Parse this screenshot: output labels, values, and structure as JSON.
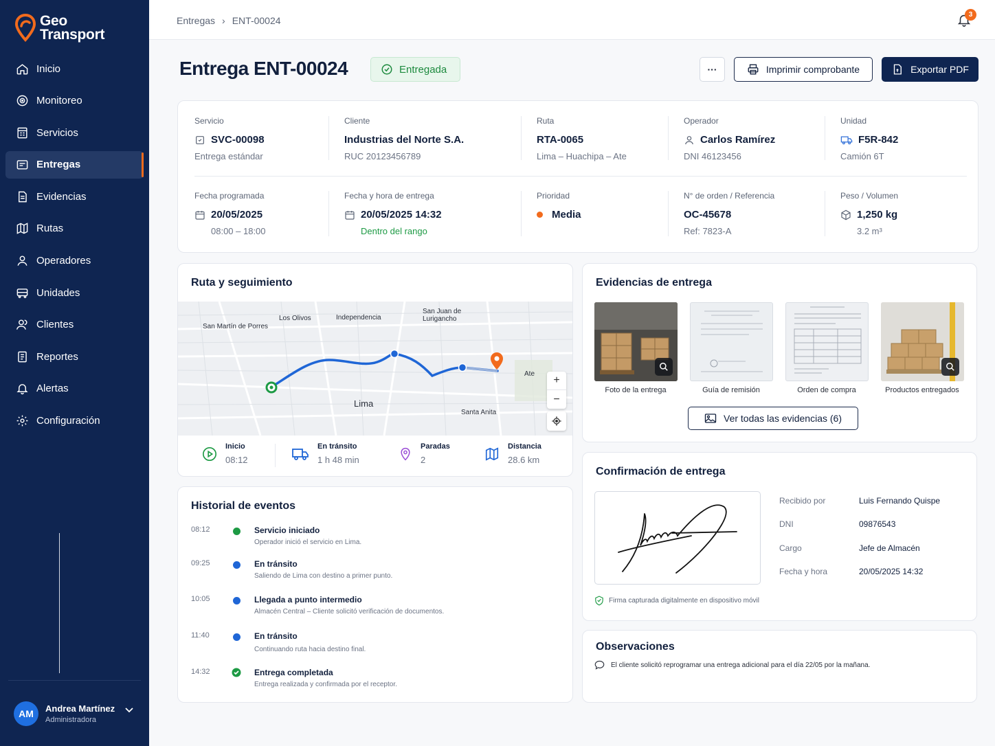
{
  "app": {
    "logo_line1": "Geo",
    "logo_line2": "Transport"
  },
  "sidebar": {
    "items": [
      {
        "label": "Inicio",
        "icon": "home-icon"
      },
      {
        "label": "Monitoreo",
        "icon": "monitor-icon"
      },
      {
        "label": "Servicios",
        "icon": "services-icon"
      },
      {
        "label": "Entregas",
        "icon": "deliveries-icon",
        "active": true
      },
      {
        "label": "Evidencias",
        "icon": "evidence-icon"
      },
      {
        "label": "Rutas",
        "icon": "routes-icon"
      },
      {
        "label": "Operadores",
        "icon": "operators-icon"
      },
      {
        "label": "Unidades",
        "icon": "units-icon"
      },
      {
        "label": "Clientes",
        "icon": "clients-icon"
      },
      {
        "label": "Reportes",
        "icon": "reports-icon"
      },
      {
        "label": "Alertas",
        "icon": "alerts-icon"
      },
      {
        "label": "Configuración",
        "icon": "settings-icon"
      }
    ],
    "user": {
      "initials": "AM",
      "name": "Andrea Martínez",
      "role": "Administradora"
    }
  },
  "topbar": {
    "breadcrumb": [
      "Entregas",
      "ENT-00024"
    ],
    "notifications": "3"
  },
  "header": {
    "title": "Entrega ENT-00024",
    "status": "Entregada",
    "more": "···",
    "print": "Imprimir comprobante",
    "export": "Exportar PDF"
  },
  "summary": {
    "servicio": {
      "label": "Servicio",
      "value": "SVC-00098",
      "sub": "Entrega estándar"
    },
    "cliente": {
      "label": "Cliente",
      "value": "Industrias del Norte S.A.",
      "sub": "RUC 20123456789"
    },
    "ruta": {
      "label": "Ruta",
      "value": "RTA-0065",
      "sub": "Lima – Huachipa – Ate"
    },
    "operador": {
      "label": "Operador",
      "value": "Carlos Ramírez",
      "sub": "DNI 46123456"
    },
    "unidad": {
      "label": "Unidad",
      "value": "F5R-842",
      "sub": "Camión 6T"
    },
    "fecha_prog": {
      "label": "Fecha programada",
      "value": "20/05/2025",
      "sub": "08:00 – 18:00"
    },
    "fecha_ent": {
      "label": "Fecha y hora de entrega",
      "value": "20/05/2025 14:32",
      "sub": "Dentro del rango"
    },
    "prioridad": {
      "label": "Prioridad",
      "value": "Media",
      "color": "#f26b1d"
    },
    "orden": {
      "label": "N° de orden / Referencia",
      "value": "OC-45678",
      "sub": "Ref: 7823-A"
    },
    "peso": {
      "label": "Peso / Volumen",
      "value": "1,250 kg",
      "sub": "3.2 m³"
    }
  },
  "route": {
    "title": "Ruta y seguimiento",
    "map_labels": {
      "san_martin": "San Martín de Porres",
      "los_olivos": "Los Olivos",
      "independencia": "Independencia",
      "san_juan": "San Juan de Lurigancho",
      "ate": "Ate",
      "lima": "Lima",
      "santa_anita": "Santa Anita"
    },
    "zoom_in": "+",
    "zoom_out": "−",
    "stats": [
      {
        "label": "Inicio",
        "value": "08:12",
        "icon": "play-icon"
      },
      {
        "label": "En tránsito",
        "value": "1 h 48 min",
        "icon": "truck-icon"
      },
      {
        "label": "Paradas",
        "value": "2",
        "icon": "pin-icon"
      },
      {
        "label": "Distancia",
        "value": "28.6 km",
        "icon": "map-icon"
      }
    ]
  },
  "history": {
    "title": "Historial de eventos",
    "events": [
      {
        "time": "08:12",
        "title": "Servicio iniciado",
        "desc": "Operador inició el servicio en Lima."
      },
      {
        "time": "09:25",
        "title": "En tránsito",
        "desc": "Saliendo de Lima con destino a primer punto."
      },
      {
        "time": "10:05",
        "title": "Llegada a punto intermedio",
        "desc": "Almacén Central – Cliente solicitó verificación de documentos."
      },
      {
        "time": "11:40",
        "title": "En tránsito",
        "desc": "Continuando ruta hacia destino final."
      },
      {
        "time": "14:32",
        "title": "Entrega completada",
        "desc": "Entrega realizada y confirmada por el receptor."
      }
    ]
  },
  "evidence": {
    "title": "Evidencias de entrega",
    "items": [
      {
        "caption": "Foto de la entrega"
      },
      {
        "caption": "Guía de remisión"
      },
      {
        "caption": "Orden de compra"
      },
      {
        "caption": "Productos entregados"
      }
    ],
    "view_all": "Ver todas las evidencias (6)"
  },
  "confirmation": {
    "title": "Confirmación de entrega",
    "fields": [
      {
        "label": "Recibido por",
        "value": "Luis Fernando Quispe"
      },
      {
        "label": "DNI",
        "value": "09876543"
      },
      {
        "label": "Cargo",
        "value": "Jefe de Almacén"
      },
      {
        "label": "Fecha y hora",
        "value": "20/05/2025 14:32"
      }
    ],
    "note": "Firma capturada digitalmente en dispositivo móvil"
  },
  "observations": {
    "title": "Observaciones",
    "text": "El cliente solicitó reprogramar una entrega adicional para el día 22/05 por la mañana."
  }
}
